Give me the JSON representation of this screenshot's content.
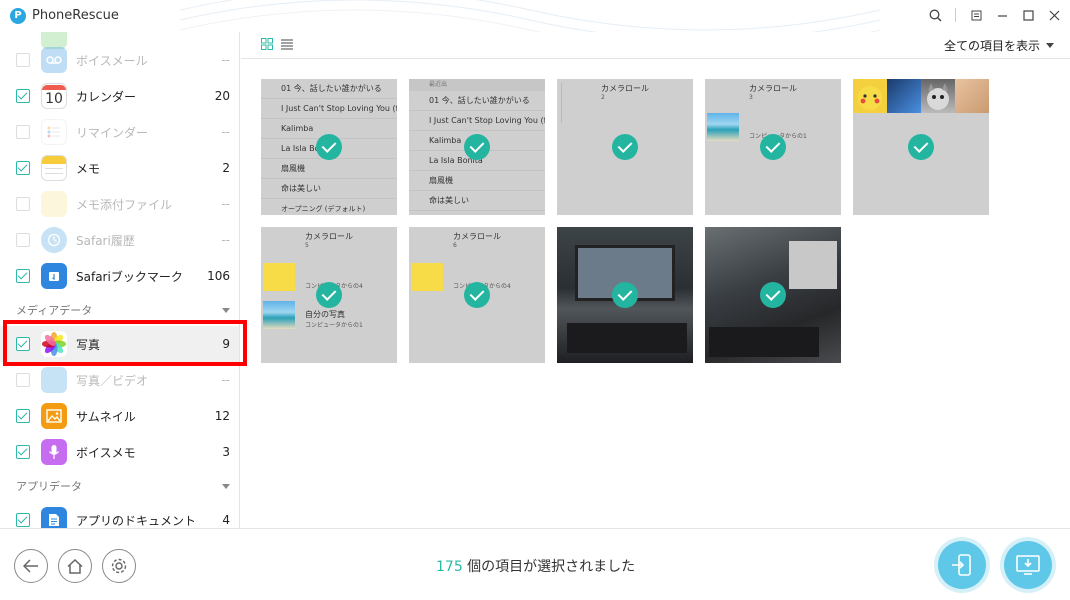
{
  "window": {
    "title": "PhoneRescue"
  },
  "sidebar": {
    "items": [
      {
        "label": "ボイスメール",
        "count": "--",
        "checked": false,
        "disabled": true,
        "icon": "voicemail-icon"
      },
      {
        "label": "カレンダー",
        "count": "20",
        "checked": true,
        "disabled": false,
        "icon": "calendar-icon",
        "icon_text": "10"
      },
      {
        "label": "リマインダー",
        "count": "--",
        "checked": false,
        "disabled": true,
        "icon": "reminders-icon"
      },
      {
        "label": "メモ",
        "count": "2",
        "checked": true,
        "disabled": false,
        "icon": "notes-icon"
      },
      {
        "label": "メモ添付ファイル",
        "count": "--",
        "checked": false,
        "disabled": true,
        "icon": "note-attachment-icon"
      },
      {
        "label": "Safari履歴",
        "count": "--",
        "checked": false,
        "disabled": true,
        "icon": "safari-history-icon"
      },
      {
        "label": "Safariブックマーク",
        "count": "106",
        "checked": true,
        "disabled": false,
        "icon": "safari-bookmark-icon"
      },
      {
        "label": "写真",
        "count": "9",
        "checked": true,
        "disabled": false,
        "icon": "photos-icon"
      },
      {
        "label": "写真／ビデオ",
        "count": "--",
        "checked": false,
        "disabled": true,
        "icon": "photo-video-icon"
      },
      {
        "label": "サムネイル",
        "count": "12",
        "checked": true,
        "disabled": false,
        "icon": "thumbnail-icon"
      },
      {
        "label": "ボイスメモ",
        "count": "3",
        "checked": true,
        "disabled": false,
        "icon": "voice-memo-icon"
      },
      {
        "label": "アプリのドキュメント",
        "count": "4",
        "checked": true,
        "disabled": false,
        "icon": "app-document-icon"
      }
    ],
    "sections": {
      "media": "メディアデータ",
      "app": "アプリデータ"
    }
  },
  "toolbar": {
    "filter_label": "全ての項目を表示"
  },
  "thumbs": {
    "song_header": "最近出",
    "songs": [
      "01 今、話したい誰かがいる",
      "I Just Can't Stop Loving You (fe...",
      "Kalimba",
      "La Isla Bonita",
      "扇風機",
      "命は美しい"
    ],
    "song_footer": "オープニング (デフォルト)",
    "camera_roll": "カメラロール",
    "counts": [
      "2",
      "3",
      "5",
      "6"
    ],
    "from_computer_1": "コンピュータからの1",
    "from_computer_4": "コンピュータからの4",
    "my_photos": "自分の写真"
  },
  "status": {
    "count": "175",
    "text": " 個の項目が選択されました"
  },
  "colors": {
    "accent": "#2cb8a6",
    "highlight": "#ff0000",
    "action": "#5fc8e8"
  }
}
